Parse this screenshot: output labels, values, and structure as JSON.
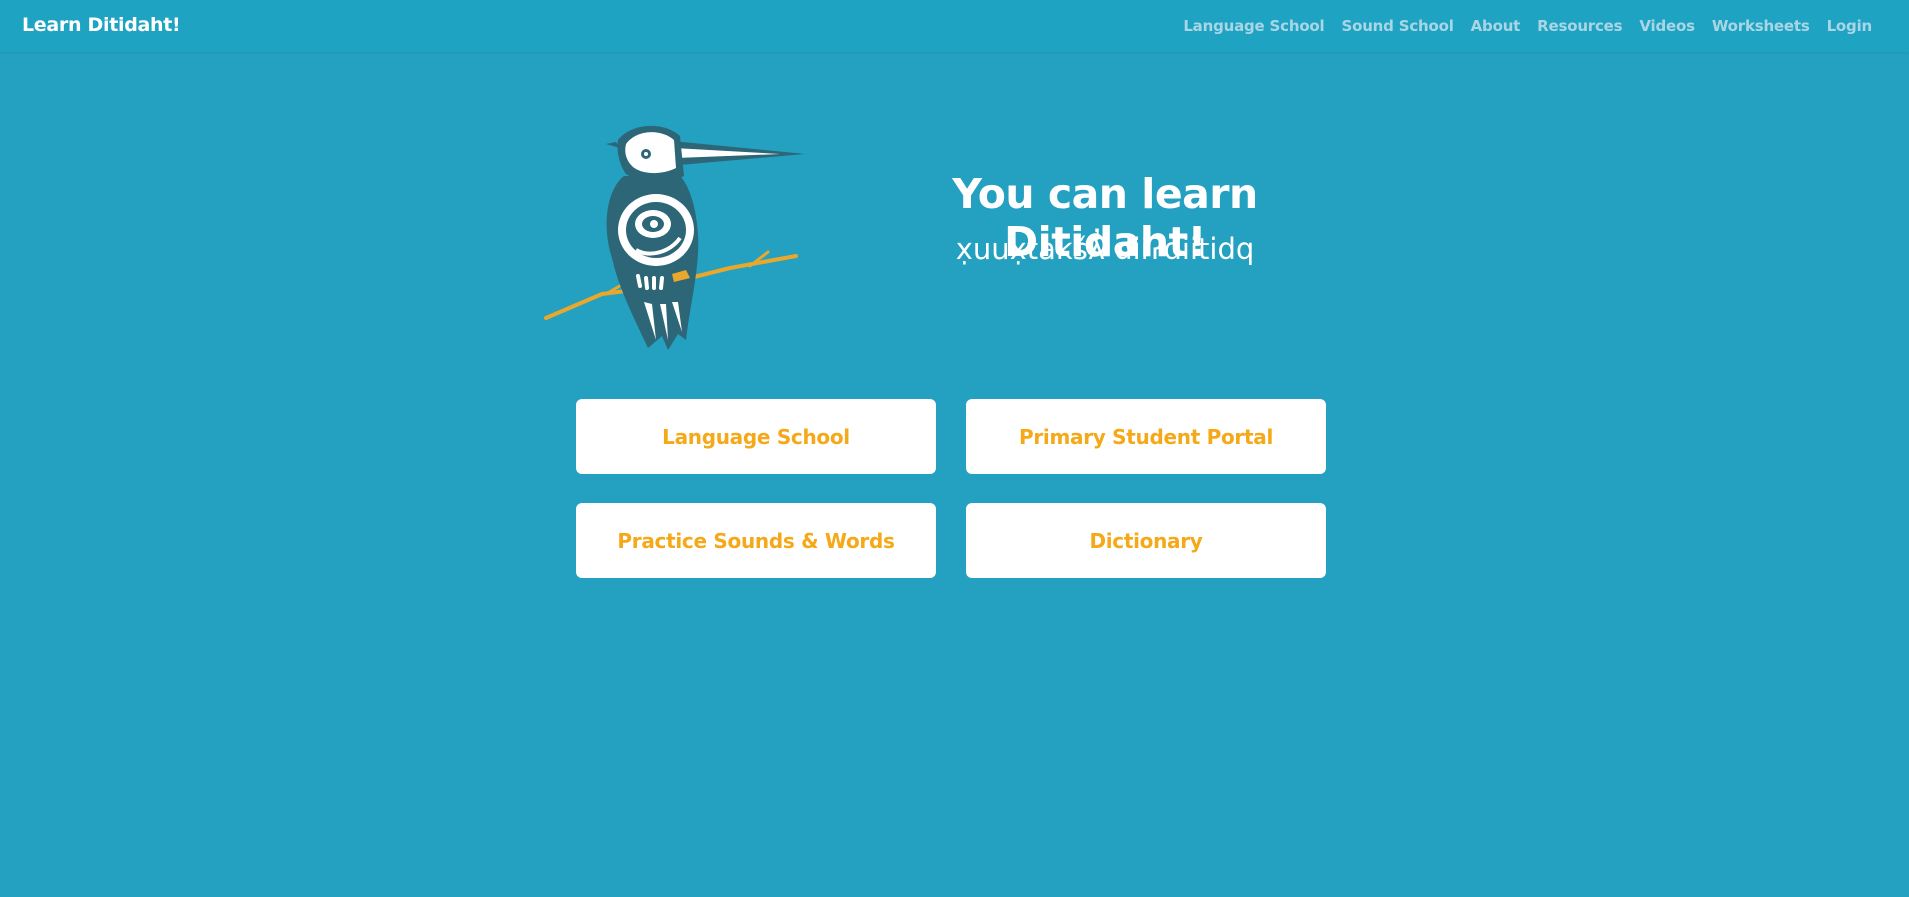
{
  "header": {
    "brand": "Learn Ditidaht!",
    "nav": [
      {
        "label": "Language School"
      },
      {
        "label": "Sound School"
      },
      {
        "label": "About"
      },
      {
        "label": "Resources"
      },
      {
        "label": "Videos"
      },
      {
        "label": "Worksheets"
      },
      {
        "label": "Login"
      }
    ]
  },
  "hero": {
    "title": "You can learn Ditidaht!",
    "subtitle": "x̣uux̣takšƛ̓ diiʔdiitidq"
  },
  "buttons": {
    "language_school": "Language School",
    "primary_portal": "Primary Student Portal",
    "practice": "Practice Sounds & Words",
    "dictionary": "Dictionary"
  },
  "colors": {
    "background": "#24a0c1",
    "header_bg": "#1fa3c3",
    "nav_text": "#a9d6e4",
    "button_text": "#f5a818",
    "bird_dark": "#2c6677",
    "branch": "#e9a82c"
  }
}
